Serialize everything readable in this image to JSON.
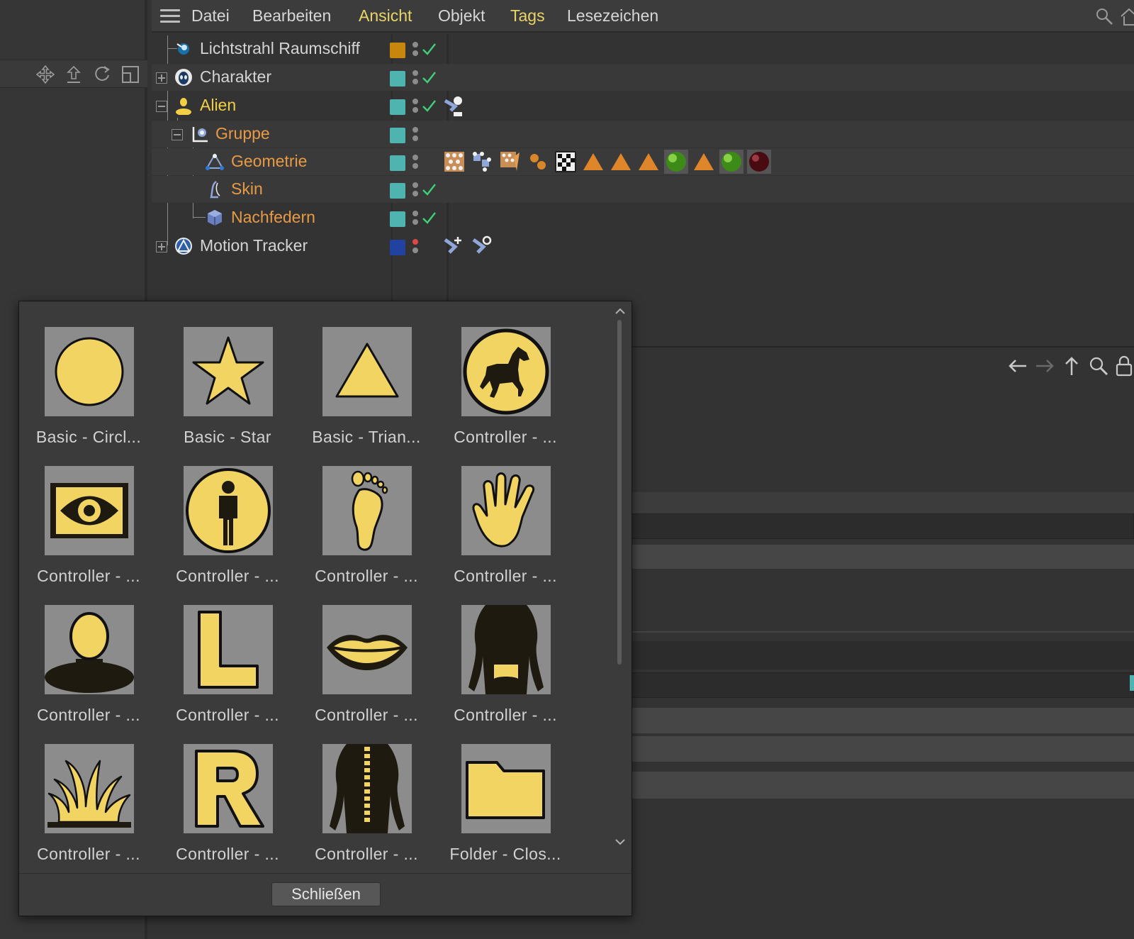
{
  "menubar": {
    "items": [
      {
        "label": "Datei",
        "highlight": false
      },
      {
        "label": "Bearbeiten",
        "highlight": false
      },
      {
        "label": "Ansicht",
        "highlight": true
      },
      {
        "label": "Objekt",
        "highlight": false
      },
      {
        "label": "Tags",
        "highlight": true
      },
      {
        "label": "Lesezeichen",
        "highlight": false
      }
    ]
  },
  "left_toolbar": {
    "icons": [
      "move-icon",
      "upload-icon",
      "rotate-icon",
      "layout-icon"
    ]
  },
  "tree": {
    "rows": [
      {
        "name": "Lichtstrahl Raumschiff",
        "color": "plain",
        "icon": "spaceship-icon",
        "layer_color": "#c9860d",
        "check": true,
        "expander": "none"
      },
      {
        "name": "Charakter",
        "color": "plain",
        "icon": "alien-face-icon",
        "layer_color": "#4fb3b0",
        "check": true,
        "expander": "plus"
      },
      {
        "name": "Alien",
        "color": "yellow",
        "icon": "alien-body-icon",
        "layer_color": "#4fb3b0",
        "check": true,
        "expander": "minus"
      },
      {
        "name": "Gruppe",
        "color": "orange",
        "icon": "group-icon",
        "layer_color": "#4fb3b0",
        "check": false,
        "expander": "minus"
      },
      {
        "name": "Geometrie",
        "color": "orange",
        "icon": "geometry-icon",
        "layer_color": "#4fb3b0",
        "check": false,
        "expander": "none"
      },
      {
        "name": "Skin",
        "color": "orange",
        "icon": "skin-icon",
        "layer_color": "#4fb3b0",
        "check": true,
        "expander": "none"
      },
      {
        "name": "Nachfedern",
        "color": "orange",
        "icon": "jiggle-icon",
        "layer_color": "#4fb3b0",
        "check": true,
        "expander": "none"
      },
      {
        "name": "Motion Tracker",
        "color": "plain",
        "icon": "motion-tracker-icon",
        "layer_color": "#2242a0",
        "check": false,
        "expander": "plus"
      }
    ],
    "geometry_tags": [
      "weight-tag-icon",
      "vertex-map-tag-icon",
      "pose-morph-tag-icon",
      "point-selection-tag-icon",
      "uvw-tag-icon",
      "polygon-selection-tag-icon",
      "polygon-selection-tag-icon",
      "polygon-selection-tag-icon",
      "green-material-tag-icon",
      "polygon-selection-tag-icon",
      "green-material-tag-icon",
      "dark-red-material-tag-icon"
    ]
  },
  "nav": {
    "icons": [
      "back-arrow-icon",
      "forward-arrow-icon",
      "up-arrow-icon",
      "search-icon",
      "lock-icon"
    ]
  },
  "popup": {
    "items": [
      {
        "label": "Basic - Circl...",
        "icon": "circle-icon"
      },
      {
        "label": "Basic - Star",
        "icon": "star-icon"
      },
      {
        "label": "Basic - Trian...",
        "icon": "triangle-icon"
      },
      {
        "label": "Controller - ...",
        "icon": "horse-icon"
      },
      {
        "label": "Controller - ...",
        "icon": "eye-icon"
      },
      {
        "label": "Controller - ...",
        "icon": "person-icon"
      },
      {
        "label": "Controller - ...",
        "icon": "foot-icon"
      },
      {
        "label": "Controller - ...",
        "icon": "hand-icon"
      },
      {
        "label": "Controller - ...",
        "icon": "head-icon"
      },
      {
        "label": "Controller - ...",
        "icon": "letter-l-icon"
      },
      {
        "label": "Controller - ...",
        "icon": "lips-icon"
      },
      {
        "label": "Controller - ...",
        "icon": "hips-icon"
      },
      {
        "label": "Controller - ...",
        "icon": "grass-icon"
      },
      {
        "label": "Controller - ...",
        "icon": "letter-r-icon"
      },
      {
        "label": "Controller - ...",
        "icon": "spine-icon"
      },
      {
        "label": "Folder - Clos...",
        "icon": "folder-closed-icon"
      }
    ],
    "close_label": "Schließen"
  }
}
